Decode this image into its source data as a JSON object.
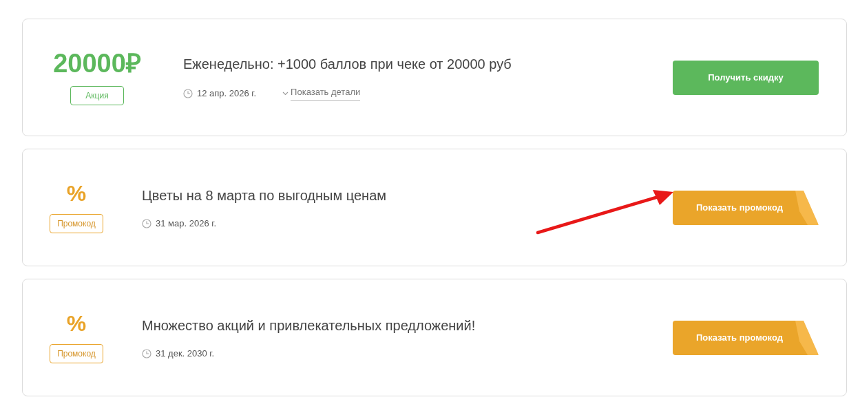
{
  "offers": [
    {
      "kind": "discount",
      "value": "20000₽",
      "badge": "Акция",
      "title": "Еженедельно: +1000 баллов при чеке от 20000 руб",
      "date": "12 апр. 2026 г.",
      "details_link": "Показать детали",
      "button": "Получить скидку",
      "highlighted": false
    },
    {
      "kind": "promo",
      "value": "%",
      "badge": "Промокод",
      "title": "Цветы на 8 марта по выгодным ценам",
      "date": "31 мар. 2026 г.",
      "button": "Показать промокод",
      "highlighted": true
    },
    {
      "kind": "promo",
      "value": "%",
      "badge": "Промокод",
      "title": "Множество акций и привлекательных предложений!",
      "date": "31 дек. 2030 г.",
      "button": "Показать промокод",
      "highlighted": false
    }
  ]
}
